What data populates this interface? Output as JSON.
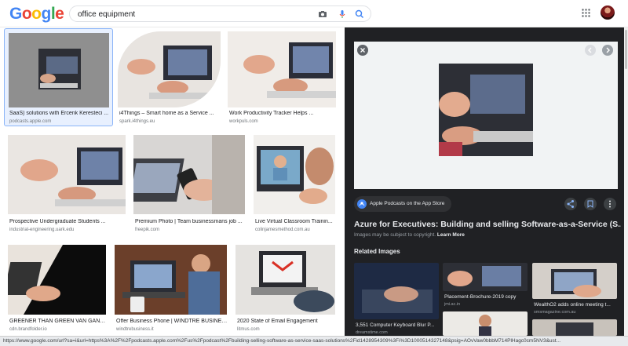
{
  "header": {
    "logo_letters": [
      "G",
      "o",
      "o",
      "g",
      "l",
      "e"
    ],
    "search_value": "office equipment"
  },
  "results": [
    {
      "caption": "SaaS) solutions with Ercenk Keresteci ...",
      "source": "podcasts.apple.com",
      "selected": true
    },
    {
      "caption": "i4Things – Smart home as a Service ...",
      "source": "spark.i4things.eu"
    },
    {
      "caption": "Work Productivity Tracker Helps ...",
      "source": "workpuls.com"
    },
    {
      "caption": "Prospective Undergraduate Students ...",
      "source": "industrial-engineering.uark.edu"
    },
    {
      "caption": "Premium Photo | Team businessmans job ...",
      "source": "freepik.com"
    },
    {
      "caption": "Live Virtual Classroom Trainin...",
      "source": "colinjamesmethod.com.au"
    },
    {
      "caption": "GREENER THAN GREEN VAN GANSE...",
      "source": "cdn.brandfolder.io"
    },
    {
      "caption": "Offer Business Phone | WINDTRE BUSINESS",
      "source": "windtrebusiness.it"
    },
    {
      "caption": "2020 State of Email Engagement",
      "source": "litmus.com"
    }
  ],
  "panel": {
    "source_pill": "Apple Podcasts on the App Store",
    "title": "Azure for Executives: Building and selling Software-as-a-Service (S...",
    "copyright_note": "Images may be subject to copyright.",
    "learn_more": "Learn More",
    "related_heading": "Related Images",
    "related": [
      {
        "caption": "3,551 Computer Keyboard Blur P...",
        "source": "dreamstime.com"
      },
      {
        "caption": "Placement-Brochure-2019 copy",
        "source": "jmi.ac.in"
      },
      {
        "caption": "WealthO2 adds online meeting t...",
        "source": "smsmagazine.com.au"
      }
    ]
  },
  "status_url": "https://www.google.com/url?sa=i&url=https%3A%2F%2Fpodcasts.apple.com%2Fus%2Fpodcast%2Fbuilding-selling-software-as-service-saas-solutions%2Fid1428954309%3Fi%3D1000514327148&psig=AOvVaw0bbbM714PlHagc0cm5NV3&ust..."
}
